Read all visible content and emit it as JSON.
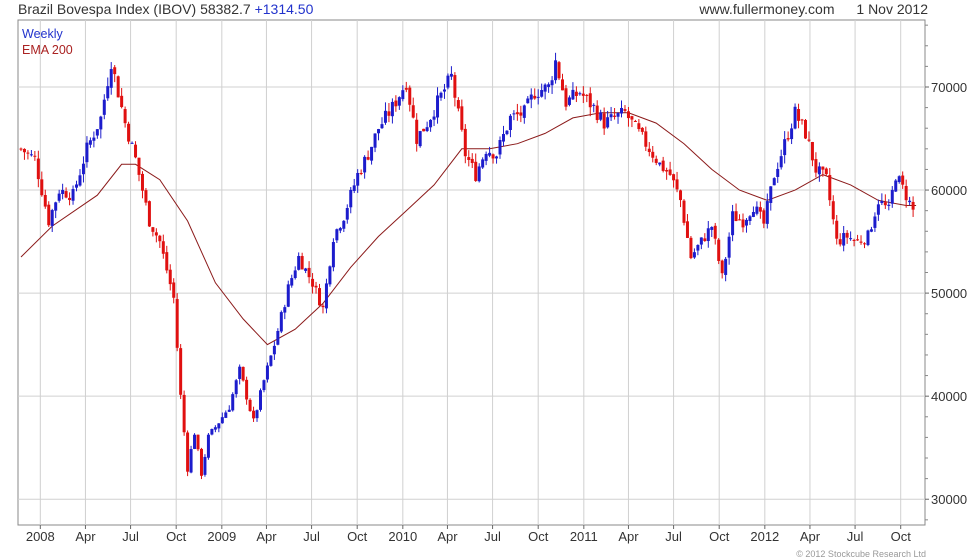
{
  "header": {
    "title": "Brazil Bovespa Index (IBOV)",
    "last": "58382.7",
    "change": "+1314.50",
    "website": "www.fullermoney.com",
    "date": "1 Nov 2012"
  },
  "legend": {
    "weekly": "Weekly",
    "ema": "EMA 200"
  },
  "footer": {
    "copyright": "© 2012 Stockcube Research Ltd"
  },
  "colors": {
    "up": "#1c1ccc",
    "down": "#e01010",
    "ema": "#8b1a1a",
    "grid": "#d0d0d0",
    "legend_weekly": "#2233cc",
    "legend_ema": "#aa2222"
  },
  "chart_data": {
    "type": "candlestick",
    "title": "Brazil Bovespa Index (IBOV)",
    "frequency": "weekly",
    "ylim": [
      27500,
      76500
    ],
    "y_ticks": [
      30000,
      40000,
      50000,
      60000,
      70000
    ],
    "y_tick_labels": [
      "30000",
      "40000",
      "50000",
      "60000",
      "70000"
    ],
    "x_ticks": [
      {
        "date": "2008-01-01",
        "label": "2008"
      },
      {
        "date": "2008-04-01",
        "label": "Apr"
      },
      {
        "date": "2008-07-01",
        "label": "Jul"
      },
      {
        "date": "2008-10-01",
        "label": "Oct"
      },
      {
        "date": "2009-01-01",
        "label": "2009"
      },
      {
        "date": "2009-04-01",
        "label": "Apr"
      },
      {
        "date": "2009-07-01",
        "label": "Jul"
      },
      {
        "date": "2009-10-01",
        "label": "Oct"
      },
      {
        "date": "2010-01-01",
        "label": "2010"
      },
      {
        "date": "2010-04-01",
        "label": "Apr"
      },
      {
        "date": "2010-07-01",
        "label": "Jul"
      },
      {
        "date": "2010-10-01",
        "label": "Oct"
      },
      {
        "date": "2011-01-01",
        "label": "2011"
      },
      {
        "date": "2011-04-01",
        "label": "Apr"
      },
      {
        "date": "2011-07-01",
        "label": "Jul"
      },
      {
        "date": "2011-10-01",
        "label": "Oct"
      },
      {
        "date": "2012-01-01",
        "label": "2012"
      },
      {
        "date": "2012-04-01",
        "label": "Apr"
      },
      {
        "date": "2012-07-01",
        "label": "Jul"
      },
      {
        "date": "2012-10-01",
        "label": "Oct"
      }
    ],
    "xlim": [
      "2007-11-17",
      "2012-11-19"
    ],
    "close_path": [
      [
        "2007-11-23",
        64000
      ],
      [
        "2007-12-21",
        63000
      ],
      [
        "2008-01-18",
        57000
      ],
      [
        "2008-02-08",
        60000
      ],
      [
        "2008-03-07",
        59500
      ],
      [
        "2008-04-04",
        64000
      ],
      [
        "2008-05-02",
        67000
      ],
      [
        "2008-05-23",
        72500
      ],
      [
        "2008-06-20",
        66500
      ],
      [
        "2008-07-11",
        63000
      ],
      [
        "2008-08-08",
        57000
      ],
      [
        "2008-08-29",
        55000
      ],
      [
        "2008-09-26",
        49500
      ],
      [
        "2008-10-10",
        40000
      ],
      [
        "2008-10-24",
        33000
      ],
      [
        "2008-11-07",
        36500
      ],
      [
        "2008-11-21",
        32500
      ],
      [
        "2008-12-05",
        36000
      ],
      [
        "2008-12-26",
        37500
      ],
      [
        "2009-01-16",
        39000
      ],
      [
        "2009-02-06",
        42500
      ],
      [
        "2009-03-06",
        37500
      ],
      [
        "2009-03-27",
        41500
      ],
      [
        "2009-04-17",
        45000
      ],
      [
        "2009-05-15",
        50500
      ],
      [
        "2009-06-05",
        53500
      ],
      [
        "2009-07-03",
        51000
      ],
      [
        "2009-07-24",
        48500
      ],
      [
        "2009-08-14",
        55500
      ],
      [
        "2009-09-04",
        57500
      ],
      [
        "2009-10-02",
        61500
      ],
      [
        "2009-10-23",
        63500
      ],
      [
        "2009-11-13",
        66000
      ],
      [
        "2009-12-11",
        68000
      ],
      [
        "2010-01-08",
        70500
      ],
      [
        "2010-01-29",
        65000
      ],
      [
        "2010-02-19",
        66500
      ],
      [
        "2010-03-12",
        68500
      ],
      [
        "2010-04-09",
        71000
      ],
      [
        "2010-05-07",
        63500
      ],
      [
        "2010-05-28",
        61500
      ],
      [
        "2010-06-18",
        64000
      ],
      [
        "2010-07-09",
        63500
      ],
      [
        "2010-08-06",
        67000
      ],
      [
        "2010-09-03",
        67500
      ],
      [
        "2010-09-24",
        69500
      ],
      [
        "2010-10-22",
        70000
      ],
      [
        "2010-11-05",
        72500
      ],
      [
        "2010-11-26",
        68500
      ],
      [
        "2010-12-24",
        69500
      ],
      [
        "2011-01-21",
        68000
      ],
      [
        "2011-02-11",
        66500
      ],
      [
        "2011-03-04",
        67000
      ],
      [
        "2011-03-25",
        67500
      ],
      [
        "2011-04-15",
        66000
      ],
      [
        "2011-05-13",
        64000
      ],
      [
        "2011-06-03",
        62500
      ],
      [
        "2011-06-24",
        61500
      ],
      [
        "2011-07-15",
        59000
      ],
      [
        "2011-08-05",
        53500
      ],
      [
        "2011-08-26",
        55000
      ],
      [
        "2011-09-16",
        56500
      ],
      [
        "2011-10-07",
        51500
      ],
      [
        "2011-10-28",
        57500
      ],
      [
        "2011-11-18",
        57000
      ],
      [
        "2011-12-09",
        58500
      ],
      [
        "2011-12-30",
        56700
      ],
      [
        "2012-01-20",
        61500
      ],
      [
        "2012-02-10",
        64500
      ],
      [
        "2012-03-02",
        67500
      ],
      [
        "2012-03-23",
        65500
      ],
      [
        "2012-04-13",
        62000
      ],
      [
        "2012-05-04",
        61000
      ],
      [
        "2012-05-25",
        55000
      ],
      [
        "2012-06-15",
        55500
      ],
      [
        "2012-07-06",
        55000
      ],
      [
        "2012-07-27",
        55500
      ],
      [
        "2012-08-17",
        59000
      ],
      [
        "2012-09-07",
        58000
      ],
      [
        "2012-09-21",
        61500
      ],
      [
        "2012-10-12",
        59500
      ],
      [
        "2012-10-26",
        58000
      ],
      [
        "2012-11-01",
        58382.7
      ]
    ],
    "ema200_path": [
      [
        "2007-11-23",
        53500
      ],
      [
        "2008-01-25",
        56500
      ],
      [
        "2008-04-25",
        59500
      ],
      [
        "2008-06-13",
        62500
      ],
      [
        "2008-07-11",
        62500
      ],
      [
        "2008-08-29",
        61000
      ],
      [
        "2008-10-24",
        57000
      ],
      [
        "2008-12-19",
        51000
      ],
      [
        "2009-02-13",
        47500
      ],
      [
        "2009-04-03",
        45000
      ],
      [
        "2009-05-29",
        46500
      ],
      [
        "2009-07-24",
        49000
      ],
      [
        "2009-09-18",
        52500
      ],
      [
        "2009-11-13",
        55500
      ],
      [
        "2010-01-08",
        58000
      ],
      [
        "2010-03-05",
        60500
      ],
      [
        "2010-04-30",
        64000
      ],
      [
        "2010-06-25",
        64000
      ],
      [
        "2010-08-20",
        64500
      ],
      [
        "2010-10-15",
        65500
      ],
      [
        "2010-12-10",
        67000
      ],
      [
        "2011-02-04",
        67500
      ],
      [
        "2011-04-01",
        67500
      ],
      [
        "2011-05-27",
        66500
      ],
      [
        "2011-07-22",
        64500
      ],
      [
        "2011-09-16",
        62000
      ],
      [
        "2011-11-11",
        60000
      ],
      [
        "2012-01-06",
        59000
      ],
      [
        "2012-03-02",
        60000
      ],
      [
        "2012-04-27",
        61500
      ],
      [
        "2012-06-22",
        60500
      ],
      [
        "2012-08-17",
        59000
      ],
      [
        "2012-10-12",
        58500
      ],
      [
        "2012-11-01",
        58500
      ]
    ]
  }
}
